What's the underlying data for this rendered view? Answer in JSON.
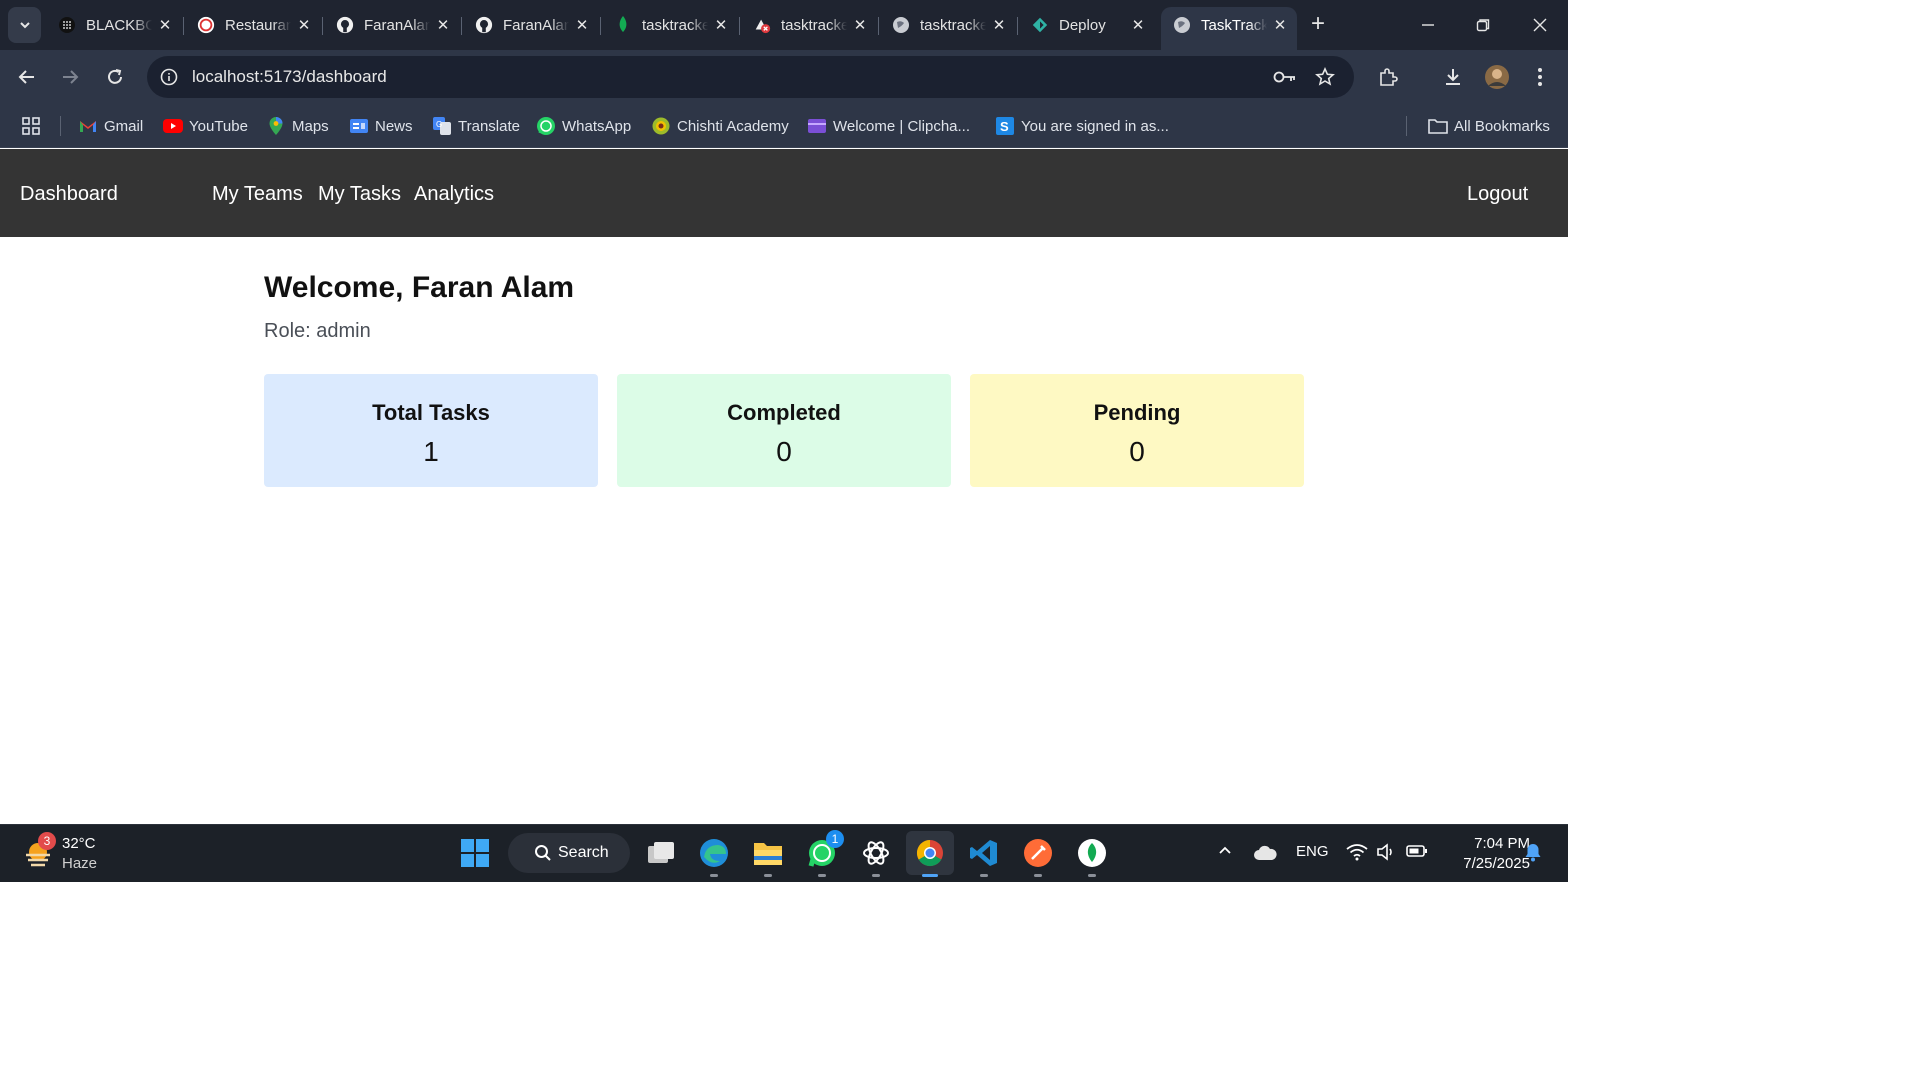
{
  "browser": {
    "tabs": [
      {
        "title": "BLACKBOX",
        "favicon": "blackbox-icon",
        "active": false
      },
      {
        "title": "Restaurant",
        "favicon": "restaurant-icon",
        "active": false
      },
      {
        "title": "FaranAlam",
        "favicon": "github-icon",
        "active": false
      },
      {
        "title": "FaranAlam",
        "favicon": "github-icon",
        "active": false
      },
      {
        "title": "tasktracker",
        "favicon": "mongodb-leaf-icon",
        "active": false
      },
      {
        "title": "tasktracker",
        "favicon": "render-failed-icon",
        "active": false
      },
      {
        "title": "tasktracker",
        "favicon": "globe-icon",
        "active": false
      },
      {
        "title": "Deploy",
        "favicon": "deploy-icon",
        "active": false
      },
      {
        "title": "TaskTracker",
        "favicon": "globe-icon",
        "active": true
      }
    ],
    "address": "localhost:5173/dashboard",
    "bookmarks": [
      {
        "label": "Gmail",
        "icon": "gmail-icon"
      },
      {
        "label": "YouTube",
        "icon": "youtube-icon"
      },
      {
        "label": "Maps",
        "icon": "maps-icon"
      },
      {
        "label": "News",
        "icon": "news-icon"
      },
      {
        "label": "Translate",
        "icon": "translate-icon"
      },
      {
        "label": "WhatsApp",
        "icon": "whatsapp-icon"
      },
      {
        "label": "Chishti Academy",
        "icon": "chishti-icon"
      },
      {
        "label": "Welcome | Clipcha...",
        "icon": "clipchamp-icon"
      },
      {
        "label": "You are signed in as...",
        "icon": "s-icon"
      }
    ],
    "all_bookmarks": "All Bookmarks"
  },
  "nav": {
    "brand": "Dashboard",
    "links": [
      "My Teams",
      "My Tasks",
      "Analytics"
    ],
    "logout": "Logout"
  },
  "dashboard": {
    "welcome": "Welcome, Faran Alam",
    "role": "Role: admin",
    "cards": [
      {
        "label": "Total Tasks",
        "value": "1",
        "color": "#dbeafe"
      },
      {
        "label": "Completed",
        "value": "0",
        "color": "#dcfce7"
      },
      {
        "label": "Pending",
        "value": "0",
        "color": "#fef9c3"
      }
    ]
  },
  "taskbar": {
    "weather_temp": "32°C",
    "weather_desc": "Haze",
    "weather_badge": "3",
    "search_label": "Search",
    "whatsapp_badge": "1",
    "language": "ENG",
    "time": "7:04 PM",
    "date": "7/25/2025"
  },
  "colors": {
    "tabstrip": "#1f2430",
    "toolbar": "#2e3647",
    "app_nav": "#343434",
    "taskbar": "#1c2128"
  }
}
